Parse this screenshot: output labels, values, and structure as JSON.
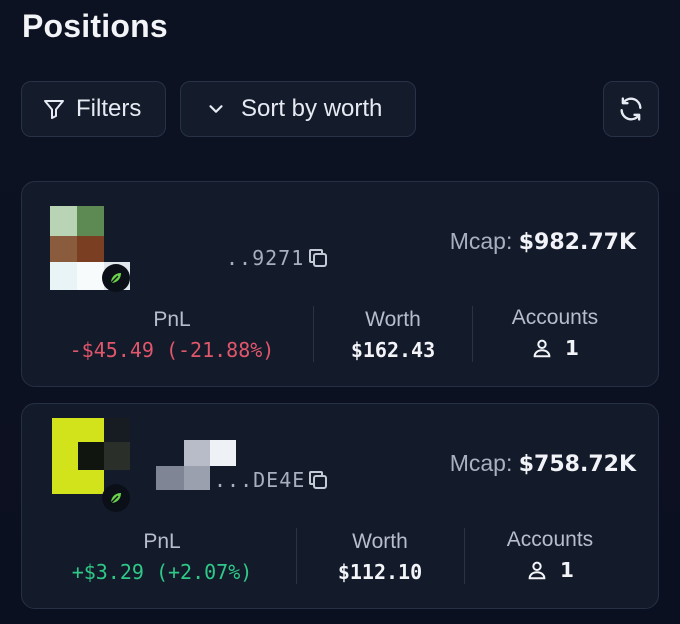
{
  "page": {
    "title": "Positions"
  },
  "toolbar": {
    "filters_label": "Filters",
    "sort_label": "Sort by worth",
    "icons": {
      "filters": "filter-icon",
      "sort": "chevron-down-icon",
      "refresh": "refresh-icon"
    }
  },
  "positions": [
    {
      "address_suffix": "..9271",
      "mcap_label": "Mcap:",
      "mcap_value": "$982.77K",
      "pnl_label": "PnL",
      "pnl_value": "-$45.49 (-21.88%)",
      "pnl_color": "#e0566b",
      "worth_label": "Worth",
      "worth_value": "$162.43",
      "accounts_label": "Accounts",
      "accounts_value": "1"
    },
    {
      "address_suffix": "...DE4E",
      "mcap_label": "Mcap:",
      "mcap_value": "$758.72K",
      "pnl_label": "PnL",
      "pnl_value": "+$3.29 (+2.07%)",
      "pnl_color": "#2fc987",
      "worth_label": "Worth",
      "worth_value": "$112.10",
      "accounts_label": "Accounts",
      "accounts_value": "1"
    }
  ],
  "colors": {
    "background": "#0c1120",
    "card": "#131a2a",
    "negative": "#e0566b",
    "positive": "#2fc987",
    "badge_leaf": "#6ad34a"
  }
}
